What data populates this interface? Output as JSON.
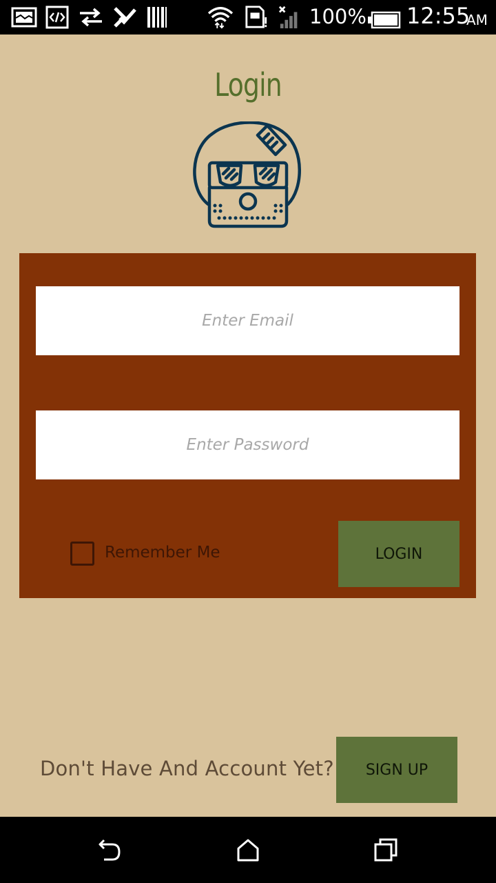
{
  "status_bar": {
    "battery": "100%",
    "time": "12:55",
    "ampm": "AM",
    "icons": [
      "screenshot-icon",
      "code-icon",
      "data-transfer-icon",
      "checklist-icon",
      "barcode-icon",
      "wifi-icon",
      "sim-alert-icon",
      "signal-icon",
      "battery-icon"
    ]
  },
  "page": {
    "title": "Login"
  },
  "form": {
    "email_placeholder": "Enter Email",
    "password_placeholder": "Enter Password",
    "remember_label": "Remember Me",
    "login_label": "LOGIN"
  },
  "signup": {
    "prompt": "Don't Have And Account Yet?",
    "button_label": "SIGN UP"
  },
  "nav_bar": {
    "buttons": [
      "back-icon",
      "home-icon",
      "recents-icon"
    ]
  },
  "colors": {
    "background": "#d9c39c",
    "card": "#833206",
    "button": "#5e733a",
    "title": "#556f2c",
    "mascot": "#0b3550"
  }
}
